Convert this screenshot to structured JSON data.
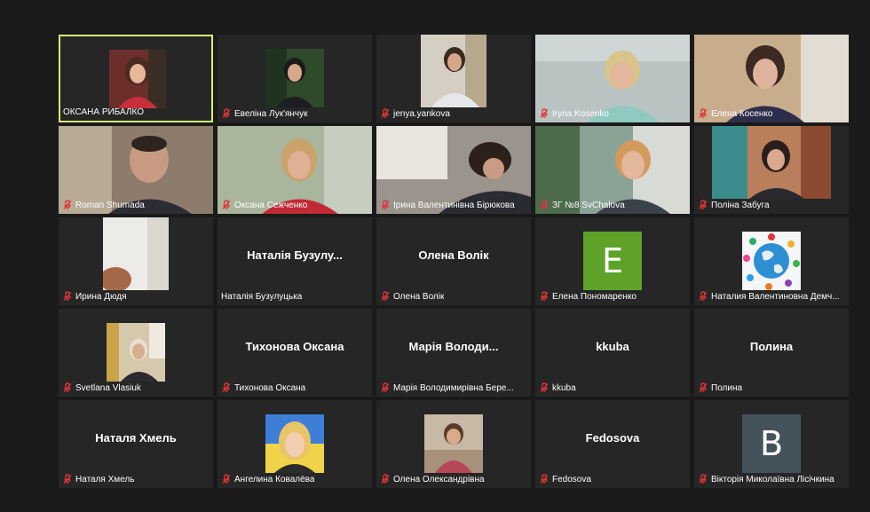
{
  "meeting": {
    "participants": [
      {
        "name": "ОКСАНА РИБАЛКО",
        "muted": false,
        "active": true,
        "kind": "photo",
        "photo_bg": "#b8343b"
      },
      {
        "name": "Евеліна Лук'янчук",
        "muted": true,
        "kind": "photo",
        "photo_bg": "#2f4a2a"
      },
      {
        "name": "jenya.yankova",
        "muted": true,
        "kind": "video",
        "photo_bg": "#c9c4b8"
      },
      {
        "name": "Iryna Kosenko",
        "muted": true,
        "kind": "video",
        "photo_bg": "#b7c1bf"
      },
      {
        "name": "Елена Косенко",
        "muted": true,
        "kind": "video",
        "photo_bg": "#c4a98a"
      },
      {
        "name": "Roman Shumada",
        "muted": true,
        "kind": "video",
        "photo_bg": "#9a8a78"
      },
      {
        "name": "Оксана Сежченко",
        "muted": true,
        "kind": "video",
        "photo_bg": "#a4b39a"
      },
      {
        "name": "Ірина Валентинівна Бірюкова",
        "muted": true,
        "kind": "video",
        "photo_bg": "#8d8a86"
      },
      {
        "name": "ЗГ №8 SvChalova",
        "muted": true,
        "kind": "video",
        "photo_bg": "#6f8a6e"
      },
      {
        "name": "Поліна Забуга",
        "muted": true,
        "kind": "video",
        "photo_bg": "#9c6b50"
      },
      {
        "name": "Ирина Дюдя",
        "muted": true,
        "kind": "video",
        "photo_bg": "#e7e6e2"
      },
      {
        "name": "Наталія Бузулуцька",
        "muted": false,
        "kind": "text",
        "display": "Наталія Бузулу..."
      },
      {
        "name": "Олена Волік",
        "muted": true,
        "kind": "text",
        "display": "Олена Волік"
      },
      {
        "name": "Елена Пономаренко",
        "muted": true,
        "kind": "letter",
        "letter": "E",
        "letter_bg": "#5ea22a"
      },
      {
        "name": "Наталия Валентиновна Демч...",
        "muted": true,
        "kind": "photo",
        "photo_bg": "#f4f6f8"
      },
      {
        "name": "Svetlana Vlasiuk",
        "muted": true,
        "kind": "photo",
        "photo_bg": "#cfc2a8"
      },
      {
        "name": "Тихонова Оксана",
        "muted": true,
        "kind": "text",
        "display": "Тихонова Оксана"
      },
      {
        "name": "Марія Володимирівна Бере...",
        "muted": true,
        "kind": "text",
        "display": "Марія Володи..."
      },
      {
        "name": "kkuba",
        "muted": true,
        "kind": "text",
        "display": "kkuba"
      },
      {
        "name": "Полина",
        "muted": true,
        "kind": "text",
        "display": "Полина"
      },
      {
        "name": "Наталя Хмель",
        "muted": true,
        "kind": "text",
        "display": "Наталя Хмель"
      },
      {
        "name": "Ангелина Ковалёва",
        "muted": true,
        "kind": "photo",
        "photo_bg": "#f1d34a"
      },
      {
        "name": "Олена Олександрівна",
        "muted": true,
        "kind": "photo",
        "photo_bg": "#c7b9a5"
      },
      {
        "name": "Fedosova",
        "muted": true,
        "kind": "text",
        "display": "Fedosova"
      },
      {
        "name": "Вікторія Миколаївна Лісічкина",
        "muted": true,
        "kind": "letter",
        "letter": "B",
        "letter_bg": "#44525c"
      }
    ]
  },
  "colors": {
    "background": "#1a1a1a",
    "tile": "#262626",
    "active_border": "#d5ef7a",
    "muted_icon": "#e0343a"
  }
}
